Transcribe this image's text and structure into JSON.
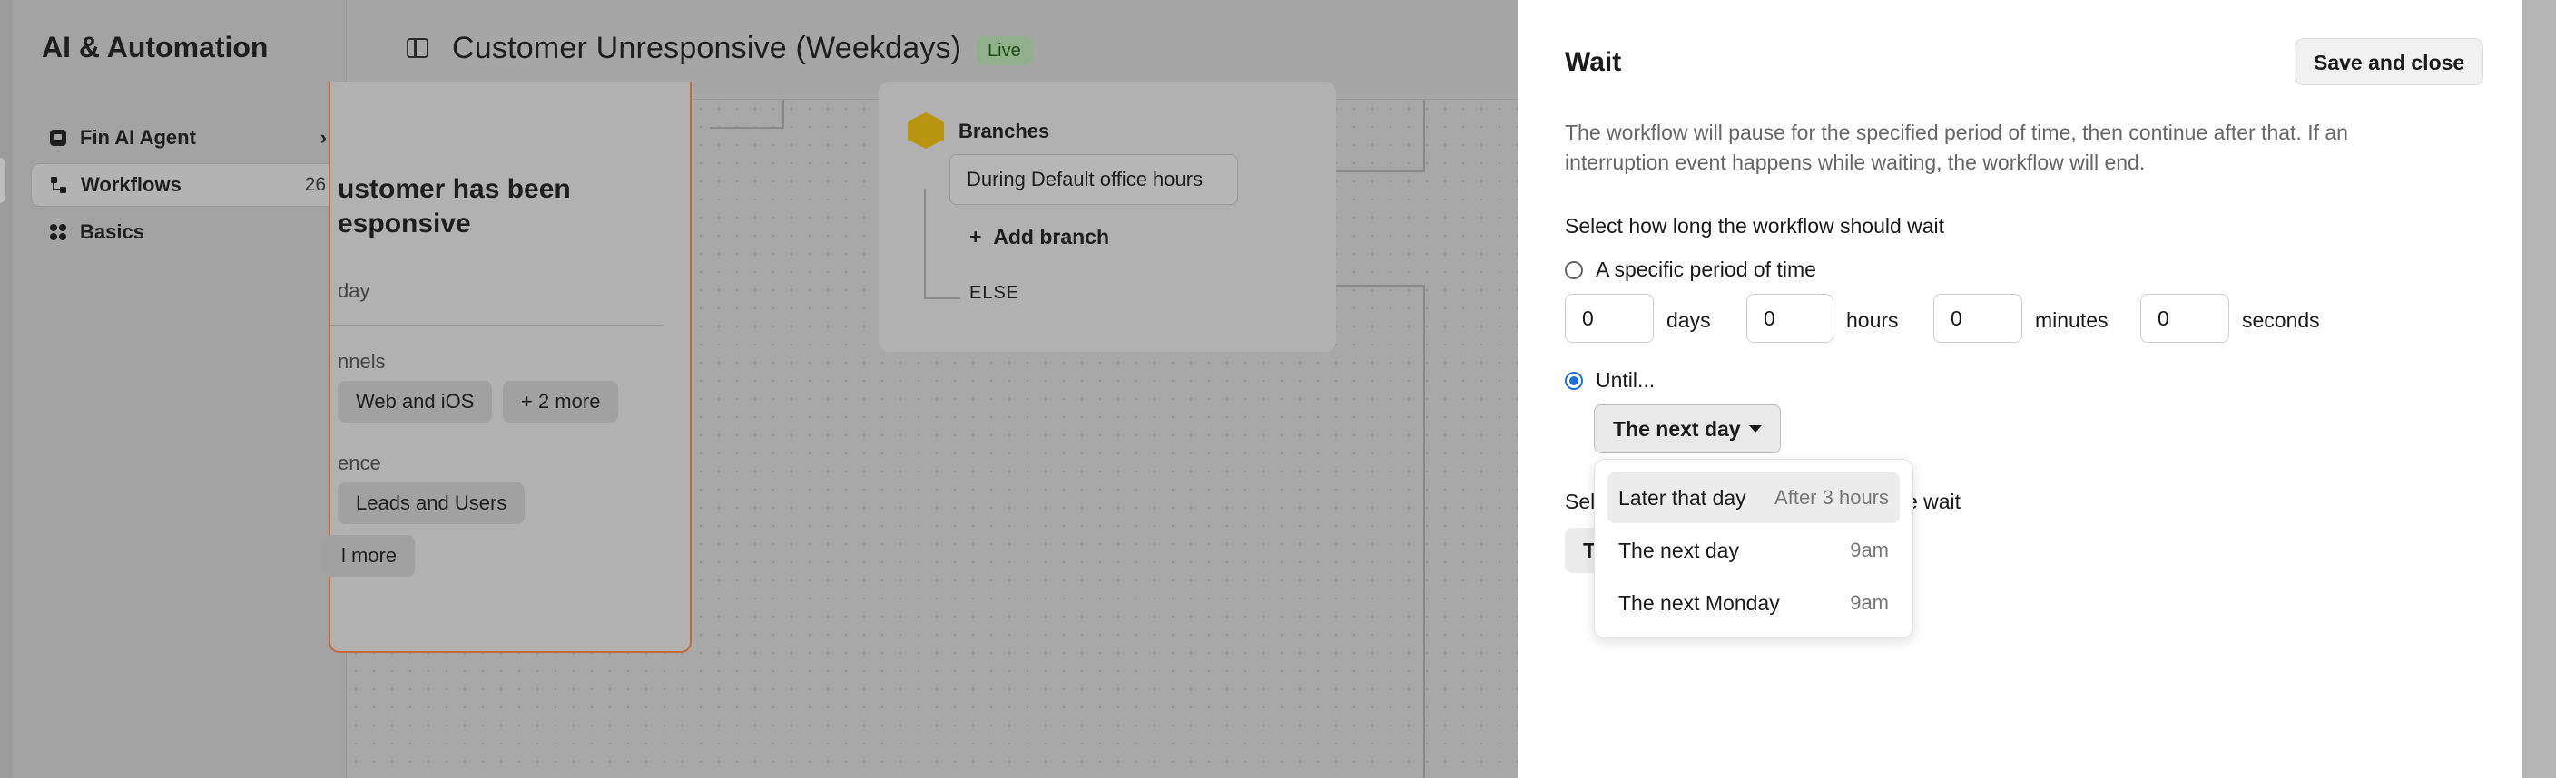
{
  "sidebar": {
    "title": "AI & Automation",
    "items": [
      {
        "label": "Fin AI Agent",
        "count": ""
      },
      {
        "label": "Workflows",
        "count": "26"
      },
      {
        "label": "Basics",
        "count": ""
      }
    ]
  },
  "header": {
    "title": "Customer Unresponsive (Weekdays)",
    "status": "Live"
  },
  "canvas": {
    "trigger_card": {
      "title_line1": "ustomer has been",
      "title_line2": "esponsive",
      "subtitle": "day",
      "channels_label": "nnels",
      "channel_chip": "Web and iOS",
      "channel_more": "+ 2 more",
      "audience_label": "ence",
      "audience_chip": "Leads and Users",
      "audience_more": "l more"
    },
    "branch_card": {
      "title": "Branches",
      "branch": "During Default office hours",
      "add_branch": "Add branch",
      "else": "ELSE"
    }
  },
  "panel": {
    "title": "Wait",
    "save_label": "Save and close",
    "description": "The workflow will pause for the specified period of time, then continue after that. If an interruption event happens while waiting, the workflow will end.",
    "question": "Select how long the workflow should wait",
    "option_specific": "A specific period of time",
    "days_value": "0",
    "days_unit": "days",
    "hours_value": "0",
    "hours_unit": "hours",
    "minutes_value": "0",
    "minutes_unit": "minutes",
    "seconds_value": "0",
    "seconds_unit": "seconds",
    "option_until": "Until...",
    "until_selected": "The next day",
    "under_text_left": "Sel",
    "under_text_right": "t the wait",
    "under_button": "T",
    "menu": [
      {
        "label": "Later that day",
        "hint": "After 3 hours"
      },
      {
        "label": "The next day",
        "hint": "9am"
      },
      {
        "label": "The next Monday",
        "hint": "9am"
      }
    ]
  },
  "colors": {
    "accent": "#1d6fe0",
    "live_badge": "#8fb08b",
    "trigger_border": "#c76a3a",
    "branch_icon": "#b8950e"
  }
}
